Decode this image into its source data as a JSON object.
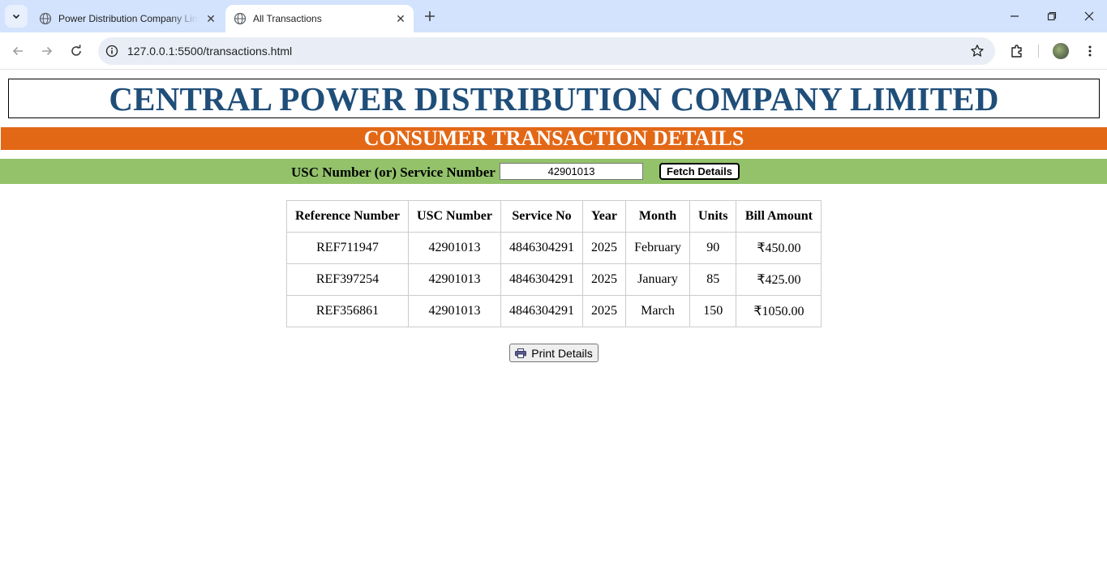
{
  "browser": {
    "tabs": [
      {
        "title": "Power Distribution Company Limited",
        "active": false
      },
      {
        "title": "All Transactions",
        "active": true
      }
    ],
    "url": "127.0.0.1:5500/transactions.html"
  },
  "page": {
    "company_title": "CENTRAL POWER DISTRIBUTION COMPANY LIMITED",
    "section_title": "CONSUMER TRANSACTION DETAILS",
    "search": {
      "label": "USC Number (or) Service Number",
      "value": "42901013",
      "button_label": "Fetch Details"
    },
    "table": {
      "headers": [
        "Reference Number",
        "USC Number",
        "Service No",
        "Year",
        "Month",
        "Units",
        "Bill Amount"
      ],
      "rows": [
        [
          "REF711947",
          "42901013",
          "4846304291",
          "2025",
          "February",
          "90",
          "₹450.00"
        ],
        [
          "REF397254",
          "42901013",
          "4846304291",
          "2025",
          "January",
          "85",
          "₹425.00"
        ],
        [
          "REF356861",
          "42901013",
          "4846304291",
          "2025",
          "March",
          "150",
          "₹1050.00"
        ]
      ]
    },
    "print_button_label": "Print Details"
  },
  "colors": {
    "tabstrip": "#d3e3fd",
    "company_title": "#1f4e79",
    "orange_bar": "#e36816",
    "green_bar": "#93c26b"
  }
}
